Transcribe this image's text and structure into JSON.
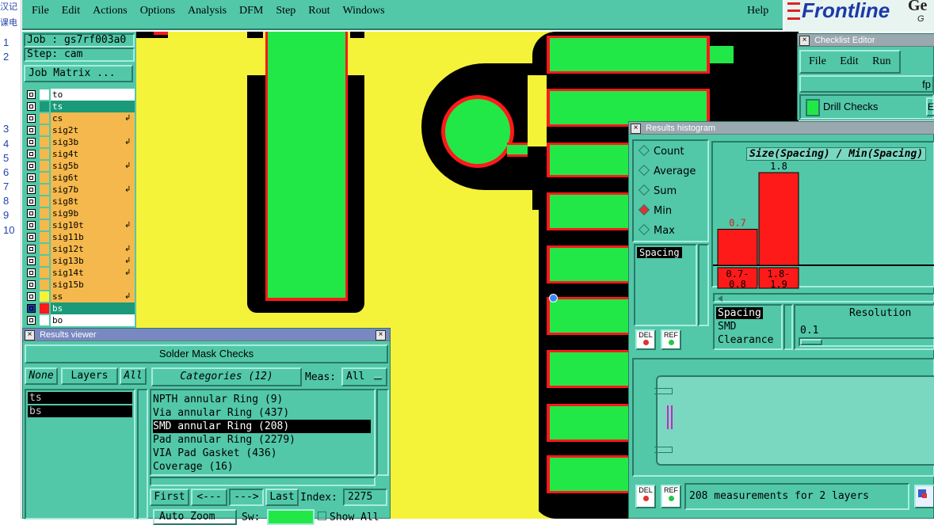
{
  "left_strip": {
    "top_fragments": [
      "汉记",
      "课电"
    ],
    "line_numbers": [
      "1",
      "2",
      "3",
      "4",
      "5",
      "6",
      "7",
      "8",
      "9",
      "10"
    ]
  },
  "menu": {
    "items": [
      "File",
      "Edit",
      "Actions",
      "Options",
      "Analysis",
      "DFM",
      "Step",
      "Rout",
      "Windows"
    ],
    "help": "Help"
  },
  "brand": {
    "logo": "Frontline",
    "frag1": "Ge",
    "frag2": "G"
  },
  "job": {
    "job_label": "Job : gs7rf003a0",
    "step_label": "Step: cam",
    "matrix_button": "Job Matrix ..."
  },
  "layers": [
    {
      "name": "to",
      "color": "#ffffff",
      "text_bg": "#ffffff",
      "arrow": false
    },
    {
      "name": "ts",
      "color": "#1a9a78",
      "text_bg": "#1a9a78",
      "arrow": false
    },
    {
      "name": "cs",
      "color": "#f5b84c",
      "text_bg": "#f5b84c",
      "arrow": true
    },
    {
      "name": "sig2t",
      "color": "#f5b84c",
      "text_bg": "#f5b84c",
      "arrow": false
    },
    {
      "name": "sig3b",
      "color": "#f5b84c",
      "text_bg": "#f5b84c",
      "arrow": true
    },
    {
      "name": "sig4t",
      "color": "#f5b84c",
      "text_bg": "#f5b84c",
      "arrow": false
    },
    {
      "name": "sig5b",
      "color": "#f5b84c",
      "text_bg": "#f5b84c",
      "arrow": true
    },
    {
      "name": "sig6t",
      "color": "#f5b84c",
      "text_bg": "#f5b84c",
      "arrow": false
    },
    {
      "name": "sig7b",
      "color": "#f5b84c",
      "text_bg": "#f5b84c",
      "arrow": true
    },
    {
      "name": "sig8t",
      "color": "#f5b84c",
      "text_bg": "#f5b84c",
      "arrow": false
    },
    {
      "name": "sig9b",
      "color": "#f5b84c",
      "text_bg": "#f5b84c",
      "arrow": false
    },
    {
      "name": "sig10t",
      "color": "#f5b84c",
      "text_bg": "#f5b84c",
      "arrow": true
    },
    {
      "name": "sig11b",
      "color": "#f5b84c",
      "text_bg": "#f5b84c",
      "arrow": false
    },
    {
      "name": "sig12t",
      "color": "#f5b84c",
      "text_bg": "#f5b84c",
      "arrow": true
    },
    {
      "name": "sig13b",
      "color": "#f5b84c",
      "text_bg": "#f5b84c",
      "arrow": true
    },
    {
      "name": "sig14t",
      "color": "#f5b84c",
      "text_bg": "#f5b84c",
      "arrow": true
    },
    {
      "name": "sig15b",
      "color": "#f5b84c",
      "text_bg": "#f5b84c",
      "arrow": false
    },
    {
      "name": "ss",
      "color": "#f5f23a",
      "text_bg": "#f5b84c",
      "arrow": true
    },
    {
      "name": "bs",
      "color": "#ff1a1a",
      "text_bg": "#1a9a78",
      "arrow": false
    },
    {
      "name": "bo",
      "color": "#ffffff",
      "text_bg": "#ffffff",
      "arrow": false
    }
  ],
  "results_viewer": {
    "title": "Results viewer",
    "header": "Solder Mask Checks",
    "none_btn": "None",
    "layers_btn": "Layers",
    "all_btn": "All",
    "layer_list": [
      "ts",
      "bs"
    ],
    "categories_btn": "Categories (12)",
    "meas_label": "Meas:",
    "meas_value": "All",
    "categories": [
      "NPTH annular Ring (9)",
      "Via annular Ring (437)",
      "SMD annular Ring (208)",
      "Pad annular Ring (2279)",
      "VIA Pad Gasket (436)",
      "Coverage (16)"
    ],
    "selected_category": "SMD annular Ring (208)",
    "first_btn": "First",
    "prev_btn": "<---",
    "next_btn": "--->",
    "last_btn": "Last",
    "index_label": "Index:",
    "index_value": "2275",
    "auto_zoom": "Auto Zoom",
    "sw_label": "Sw:",
    "show_all": "Show All"
  },
  "checklist_editor": {
    "title": "Checklist Editor",
    "menu": [
      "File",
      "Edit",
      "Run"
    ],
    "frag_fp": "fp",
    "drill_checks": "Drill Checks",
    "frag_e": "E"
  },
  "histogram": {
    "title": "Results histogram",
    "radio_options": [
      "Count",
      "Average",
      "Sum",
      "Min",
      "Max"
    ],
    "selected_option": "Min",
    "list_item": "Spacing",
    "chart_title": "Size(Spacing) / Min(Spacing)",
    "filter_items": [
      "Spacing",
      "SMD",
      "Clearance"
    ],
    "resolution_label": "Resolution",
    "resolution_value": "0.1",
    "del_label": "DEL",
    "ref_label": "REF",
    "footer_text": "208 measurements for 2 layers"
  },
  "chart_data": {
    "type": "bar",
    "title": "Size(Spacing) / Min(Spacing)",
    "categories": [
      "0.7-0.8",
      "1.8-1.9"
    ],
    "values": [
      0.7,
      1.8
    ],
    "value_labels": [
      "0.7",
      "1.8"
    ],
    "bin_labels": [
      [
        "0.7-",
        "0.8"
      ],
      [
        "1.8-",
        "1.9"
      ]
    ],
    "ylim": [
      0,
      1.8
    ],
    "bar_color": "#ff1a1a"
  }
}
